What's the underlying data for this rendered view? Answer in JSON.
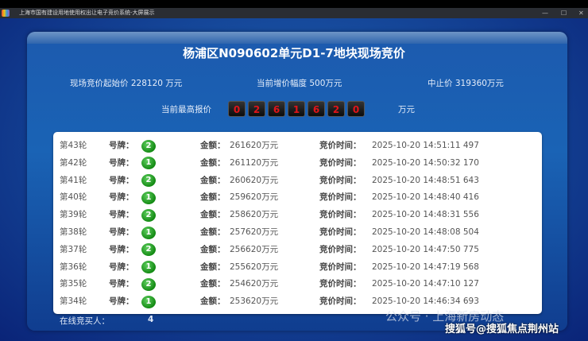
{
  "window": {
    "title": "上海市国有建设用地使用权出让电子竞价系统-大屏展示",
    "minimize": "—",
    "maximize": "☐",
    "close": "✕"
  },
  "header": {
    "title": "杨浦区N090602单元D1-7地块现场竞价",
    "start_price_label": "现场竞价起始价",
    "start_price": "228120 万元",
    "increment_label": "当前增价幅度",
    "increment": "500万元",
    "stop_price_label": "中止价",
    "stop_price": "319360万元",
    "highest_label": "当前最高报价",
    "highest_digits": [
      "0",
      "2",
      "6",
      "1",
      "6",
      "2",
      "0"
    ],
    "highest_unit": "万元"
  },
  "columns": {
    "plate": "号牌：",
    "amount": "金额：",
    "time": "竞价时间："
  },
  "rounds": [
    {
      "round": "第43轮",
      "plate": "2",
      "amount": "261620万元",
      "time": "2025-10-20 14:51:11 497"
    },
    {
      "round": "第42轮",
      "plate": "1",
      "amount": "261120万元",
      "time": "2025-10-20 14:50:32 170"
    },
    {
      "round": "第41轮",
      "plate": "2",
      "amount": "260620万元",
      "time": "2025-10-20 14:48:51 643"
    },
    {
      "round": "第40轮",
      "plate": "1",
      "amount": "259620万元",
      "time": "2025-10-20 14:48:40 416"
    },
    {
      "round": "第39轮",
      "plate": "2",
      "amount": "258620万元",
      "time": "2025-10-20 14:48:31 556"
    },
    {
      "round": "第38轮",
      "plate": "1",
      "amount": "257620万元",
      "time": "2025-10-20 14:48:08 504"
    },
    {
      "round": "第37轮",
      "plate": "2",
      "amount": "256620万元",
      "time": "2025-10-20 14:47:50 775"
    },
    {
      "round": "第36轮",
      "plate": "1",
      "amount": "255620万元",
      "time": "2025-10-20 14:47:19 568"
    },
    {
      "round": "第35轮",
      "plate": "2",
      "amount": "254620万元",
      "time": "2025-10-20 14:47:10 127"
    },
    {
      "round": "第34轮",
      "plate": "1",
      "amount": "253620万元",
      "time": "2025-10-20 14:46:34 693"
    }
  ],
  "online": {
    "label": "在线竞买人：",
    "count": "4"
  },
  "watermarks": {
    "wechat": "公众号 · 上海新房动态",
    "sohu": "搜狐号@搜狐焦点荆州站"
  }
}
